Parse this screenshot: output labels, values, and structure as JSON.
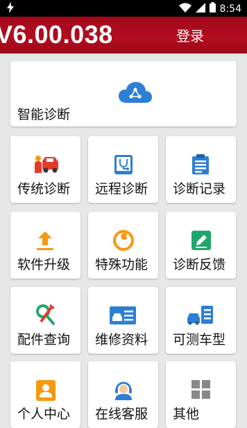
{
  "status_bar": {
    "time": "8:54"
  },
  "header": {
    "version": "V6.00.038",
    "login_label": "登录"
  },
  "featured": {
    "label": "智能诊断",
    "icon": "cloud-share-icon"
  },
  "grid": [
    {
      "label": "传统诊断",
      "icon": "mechanic-car-icon"
    },
    {
      "label": "远程诊断",
      "icon": "tablet-stethoscope-icon"
    },
    {
      "label": "诊断记录",
      "icon": "clipboard-list-icon"
    },
    {
      "label": "软件升级",
      "icon": "upload-arrow-icon"
    },
    {
      "label": "特殊功能",
      "icon": "wrench-gear-icon"
    },
    {
      "label": "诊断反馈",
      "icon": "edit-pencil-icon"
    },
    {
      "label": "配件查询",
      "icon": "parts-search-icon"
    },
    {
      "label": "维修资料",
      "icon": "car-document-icon"
    },
    {
      "label": "可测车型",
      "icon": "car-checklist-icon"
    },
    {
      "label": "个人中心",
      "icon": "user-profile-icon"
    },
    {
      "label": "在线客服",
      "icon": "headset-agent-icon"
    },
    {
      "label": "其他",
      "icon": "grid-tiles-icon"
    }
  ],
  "colors": {
    "header": "#ac0a1d",
    "icon_blue": "#2d7fd3",
    "icon_orange": "#f59a0e",
    "icon_red": "#e23b2e",
    "icon_green": "#1fa66a"
  }
}
